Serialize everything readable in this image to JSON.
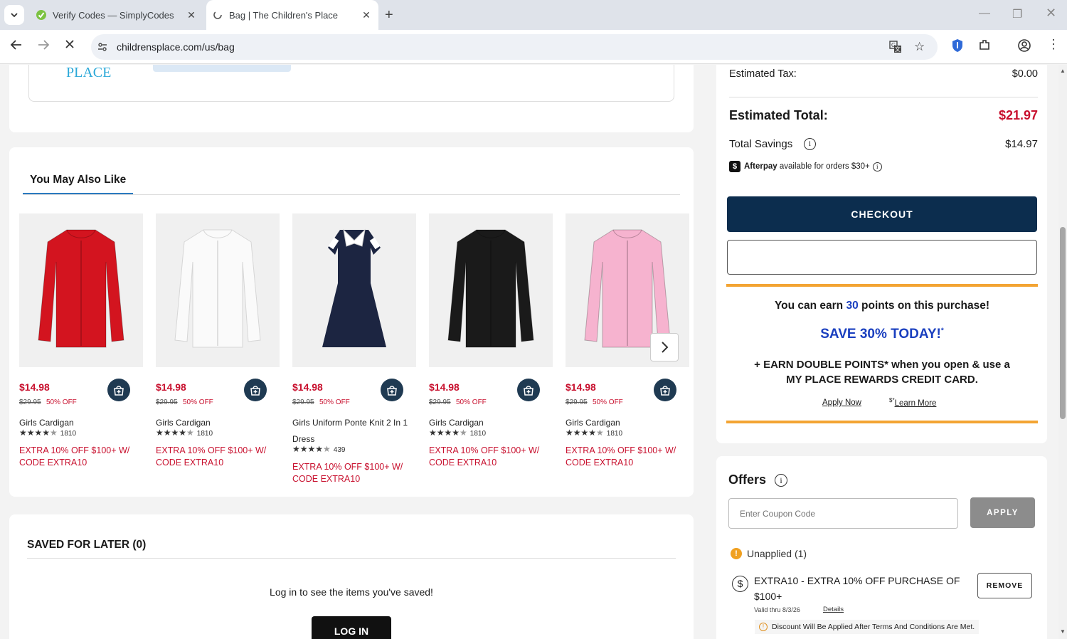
{
  "browser": {
    "tabs": [
      {
        "title": "Verify Codes — SimplyCodes",
        "active": false
      },
      {
        "title": "Bag | The Children's Place",
        "active": true
      }
    ],
    "url": "childrensplace.com/us/bag"
  },
  "top_card": {
    "logo_text": "PLACE"
  },
  "recommendations": {
    "heading": "You May Also Like",
    "products": [
      {
        "price": "$14.98",
        "was": "$29.95",
        "discount": "50% OFF",
        "name": "Girls Cardigan",
        "rating": 4.5,
        "reviews": "1810",
        "promo": "EXTRA 10% OFF $100+ W/ CODE EXTRA10",
        "color": "#d3141f"
      },
      {
        "price": "$14.98",
        "was": "$29.95",
        "discount": "50% OFF",
        "name": "Girls Cardigan",
        "rating": 4.5,
        "reviews": "1810",
        "promo": "EXTRA 10% OFF $100+ W/ CODE EXTRA10",
        "color": "#fafafa"
      },
      {
        "price": "$14.98",
        "was": "$29.95",
        "discount": "50% OFF",
        "name": "Girls Uniform Ponte Knit 2 In 1 Dress",
        "rating": 4.5,
        "reviews": "439",
        "promo": "EXTRA 10% OFF $100+ W/ CODE EXTRA10",
        "color": "#1c2541"
      },
      {
        "price": "$14.98",
        "was": "$29.95",
        "discount": "50% OFF",
        "name": "Girls Cardigan",
        "rating": 4.5,
        "reviews": "1810",
        "promo": "EXTRA 10% OFF $100+ W/ CODE EXTRA10",
        "color": "#1a1a1a"
      },
      {
        "price": "$14.98",
        "was": "$29.95",
        "discount": "50% OFF",
        "name": "Girls Cardigan",
        "rating": 4.5,
        "reviews": "1810",
        "promo": "EXTRA 10% OFF $100+ W/ CODE EXTRA10",
        "color": "#f6b3cf"
      }
    ]
  },
  "saved_for_later": {
    "heading": "SAVED FOR LATER (0)",
    "message": "Log in to see the items you've saved!",
    "login_label": "LOG IN"
  },
  "summary": {
    "tax_label": "Estimated Tax:",
    "tax_value": "$0.00",
    "total_label": "Estimated Total:",
    "total_value": "$21.97",
    "savings_label": "Total Savings",
    "savings_value": "$14.97",
    "afterpay_brand": "Afterpay",
    "afterpay_text": "available for orders $30+",
    "checkout_label": "CHECKOUT"
  },
  "rewards": {
    "earn_prefix": "You can earn",
    "earn_points": "30",
    "earn_suffix": "points on this purchase!",
    "save_text": "SAVE 30% TODAY!",
    "save_mark": "*",
    "double_line1": "+ EARN DOUBLE POINTS* when you open & use a",
    "double_line2": "MY PLACE REWARDS CREDIT CARD.",
    "apply_link": "Apply Now",
    "learn_mark": "$*",
    "learn_link": "Learn More"
  },
  "offers": {
    "heading": "Offers",
    "coupon_placeholder": "Enter Coupon Code",
    "apply_label": "APPLY",
    "unapplied_label": "Unapplied (1)",
    "coupon_title": "EXTRA10 - EXTRA 10% OFF PURCHASE OF $100+",
    "valid_text": "Valid thru 8/3/26",
    "details_link": "Details",
    "remove_label": "REMOVE",
    "notice": "Discount Will Be Applied After Terms And Conditions Are Met."
  },
  "colors": {
    "navy": "#0c2d4e",
    "red": "#c8102e",
    "blue": "#1a3fbf",
    "orange": "#f3a433"
  }
}
